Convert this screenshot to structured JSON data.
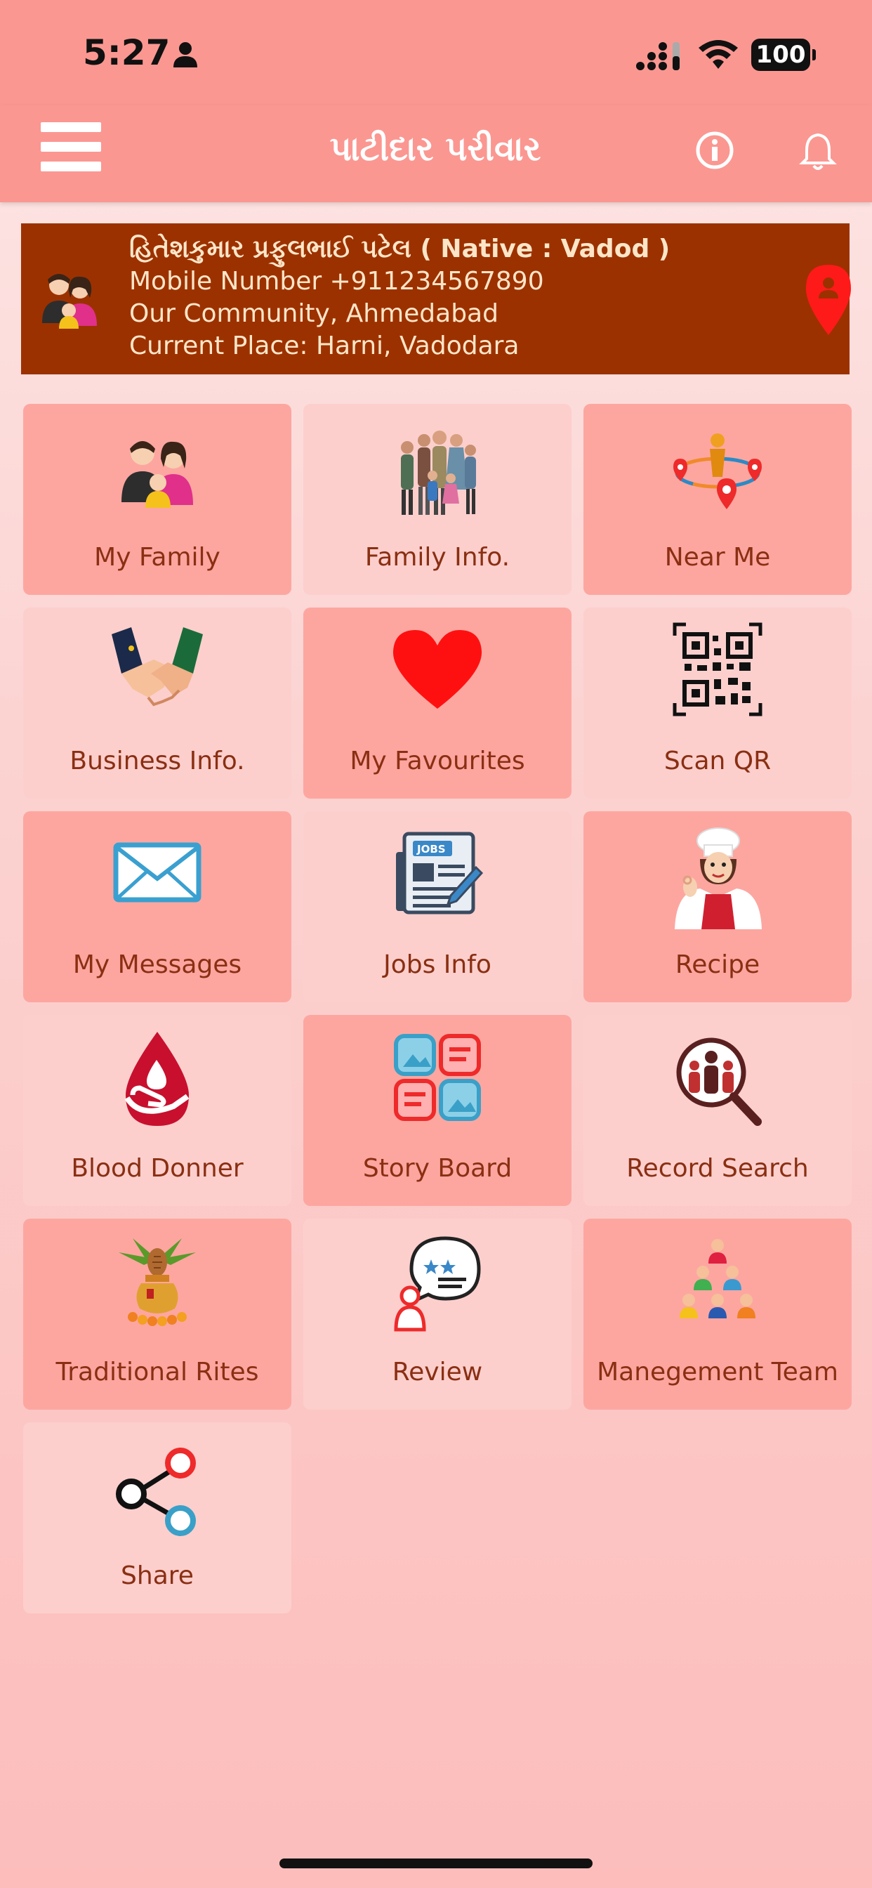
{
  "status_bar": {
    "time": "5:27",
    "battery": "100"
  },
  "header": {
    "title": "પાટીદાર પરીવાર"
  },
  "profile": {
    "name_line": "હિતેશકુમાર પ્રફુલભાઈ પટેલ ( Native : Vadod )",
    "mobile_line": "Mobile Number +911234567890",
    "community_line": "Our Community, Ahmedabad",
    "place_line": "Current Place: Harni, Vadodara"
  },
  "tiles": [
    {
      "label": "My Family",
      "icon": "family-icon"
    },
    {
      "label": "Family Info.",
      "icon": "family-group-icon"
    },
    {
      "label": "Near Me",
      "icon": "location-network-icon"
    },
    {
      "label": "Business Info.",
      "icon": "handshake-icon"
    },
    {
      "label": "My Favourites",
      "icon": "heart-icon"
    },
    {
      "label": "Scan QR",
      "icon": "qr-code-icon"
    },
    {
      "label": "My Messages",
      "icon": "envelope-icon"
    },
    {
      "label": "Jobs Info",
      "icon": "jobs-newspaper-icon"
    },
    {
      "label": "Recipe",
      "icon": "chef-icon"
    },
    {
      "label": "Blood Donner",
      "icon": "blood-drop-icon"
    },
    {
      "label": "Story Board",
      "icon": "story-board-icon"
    },
    {
      "label": "Record Search",
      "icon": "people-search-icon"
    },
    {
      "label": "Traditional Rites",
      "icon": "kalash-icon"
    },
    {
      "label": "Review",
      "icon": "review-chat-icon"
    },
    {
      "label": "Manegement Team",
      "icon": "team-pyramid-icon"
    },
    {
      "label": "Share",
      "icon": "share-icon"
    }
  ],
  "colors": {
    "header_bg": "#fb9791",
    "profile_bg": "#9c3100",
    "tile_dark": "#fda6a0",
    "tile_light": "#fccfcd",
    "label_color": "#8a2f12"
  }
}
